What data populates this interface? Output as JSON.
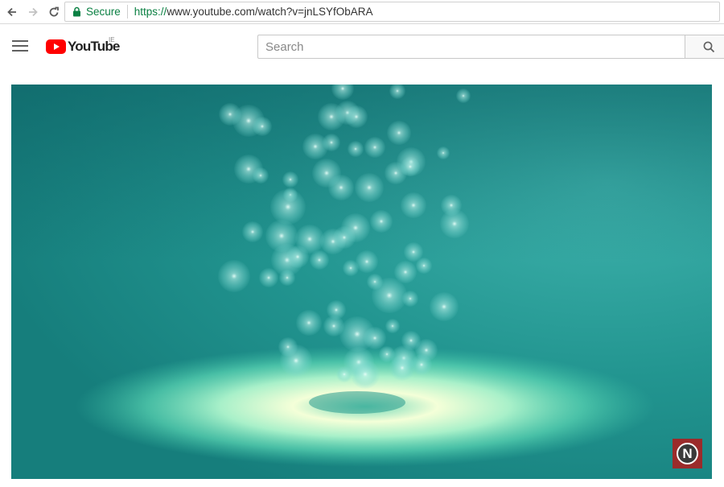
{
  "browser": {
    "back_icon": "arrow-left-icon",
    "forward_icon": "arrow-right-icon",
    "reload_icon": "reload-icon",
    "secure_label": "Secure",
    "url_protocol": "https://",
    "url_rest": "www.youtube.com/watch?v=jnLSYfObARA"
  },
  "header": {
    "menu_icon": "hamburger-menu-icon",
    "logo_text": "YouTube",
    "country_code": "IE",
    "search_placeholder": "Search",
    "search_icon": "magnifier-icon"
  },
  "video": {
    "watermark_letter": "N",
    "background_color": "#1e8f8c",
    "watermark_color": "#9b2b2b"
  },
  "colors": {
    "secure_green": "#0b8043",
    "brand_red": "#ff0000"
  }
}
